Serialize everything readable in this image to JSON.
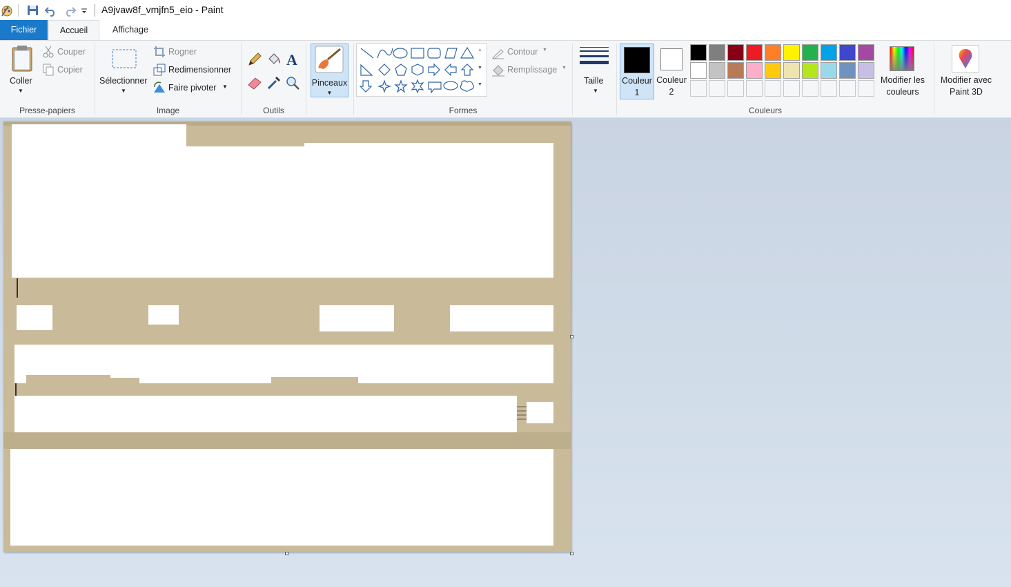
{
  "window": {
    "title": "A9jvaw8f_vmjfn5_eio - Paint"
  },
  "tabs": [
    "Fichier",
    "Accueil",
    "Affichage"
  ],
  "clipboard": {
    "paste": "Coller",
    "cut": "Couper",
    "copy": "Copier",
    "label": "Presse-papiers"
  },
  "image": {
    "select": "Sélectionner",
    "crop": "Rogner",
    "resize": "Redimensionner",
    "rotate": "Faire pivoter",
    "label": "Image"
  },
  "tools": {
    "label": "Outils"
  },
  "brushes": {
    "label": "Pinceaux"
  },
  "shapes": {
    "outline": "Contour",
    "fill": "Remplissage",
    "label": "Formes"
  },
  "size": {
    "label": "Taille"
  },
  "colors": {
    "color1_line1": "Couleur",
    "color1_line2": "1",
    "color2_line1": "Couleur",
    "color2_line2": "2",
    "edit_line1": "Modifier les",
    "edit_line2": "couleurs",
    "paint3d_line1": "Modifier avec",
    "paint3d_line2": "Paint 3D",
    "label": "Couleurs",
    "color1": "#000000",
    "color2": "#ffffff",
    "palette_row1": [
      "#000000",
      "#7f7f7f",
      "#880015",
      "#ed1c24",
      "#ff7f27",
      "#fff200",
      "#22b14c",
      "#00a2e8",
      "#3f48cc",
      "#a349a4"
    ],
    "palette_row2": [
      "#ffffff",
      "#c3c3c3",
      "#b97a57",
      "#ffaec9",
      "#ffc90e",
      "#efe4b0",
      "#b5e61d",
      "#99d9ea",
      "#7092be",
      "#c8bfe7"
    ]
  }
}
